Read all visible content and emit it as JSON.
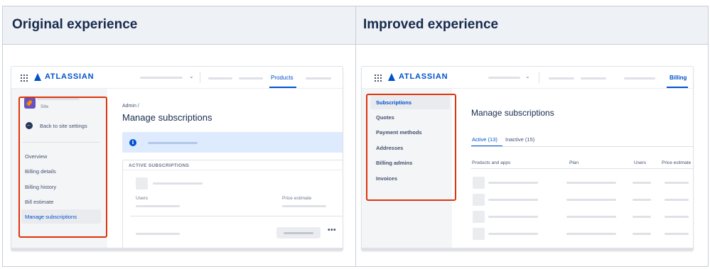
{
  "columns": {
    "left_title": "Original experience",
    "right_title": "Improved experience"
  },
  "original": {
    "brand": "ATLASSIAN",
    "nav_active": "Products",
    "site_label": "Site",
    "back_label": "Back to site settings",
    "sidebar_items": [
      "Overview",
      "Billing details",
      "Billing history",
      "Bill estimate",
      "Manage subscriptions"
    ],
    "active_item": "Manage subscriptions",
    "breadcrumb": "Admin  /",
    "page_title": "Manage subscriptions",
    "card_title": "ACTIVE SUBSCRIPTIONS",
    "users_label": "Users",
    "price_label": "Price estimate",
    "more_glyph": "•••"
  },
  "improved": {
    "brand": "ATLASSIAN",
    "nav_active": "Billing",
    "sidebar_items": [
      "Subscriptions",
      "Quotes",
      "Payment methods",
      "Addresses",
      "Billing admins",
      "Invoices"
    ],
    "active_item": "Subscriptions",
    "page_title": "Manage subscriptions",
    "tabs": [
      "Active (13)",
      "Inactive (15)"
    ],
    "table_headers": [
      "Products and apps",
      "Plan",
      "Users",
      "Price estimate"
    ]
  },
  "colors": {
    "highlight": "#de350b",
    "accent": "#0052cc",
    "sidebar_bg": "#f4f5f7",
    "header_bg": "#eef1f6"
  },
  "icons": [
    "app-grid-icon",
    "atlassian-logo-icon",
    "chevron-down-icon",
    "rocket-site-icon",
    "arrow-left-icon",
    "info-icon",
    "more-icon"
  ]
}
